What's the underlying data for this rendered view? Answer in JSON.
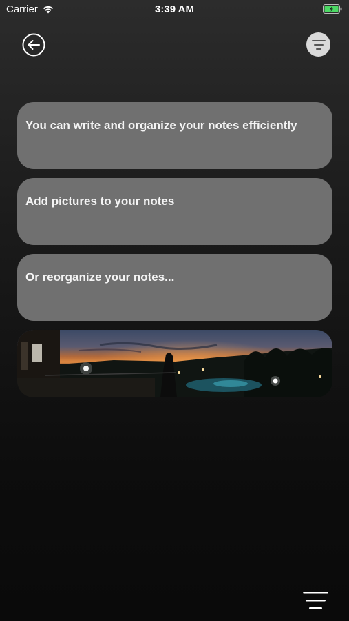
{
  "status_bar": {
    "carrier": "Carrier",
    "time": "3:39 AM"
  },
  "header": {
    "back_icon": "arrow-left-circle-icon",
    "filter_icon": "filter-lines-icon"
  },
  "notes": [
    {
      "text": "You can write and organize your notes efficiently"
    },
    {
      "text": "Add pictures to your notes"
    },
    {
      "text": "Or reorganize your notes..."
    }
  ],
  "image_note": {
    "description_icon": "sunset-photo"
  },
  "footer": {
    "menu_icon": "hamburger-menu-icon"
  },
  "colors": {
    "card": "#707070",
    "filter_bg": "#d9d9d9",
    "battery": "#4cd964"
  }
}
